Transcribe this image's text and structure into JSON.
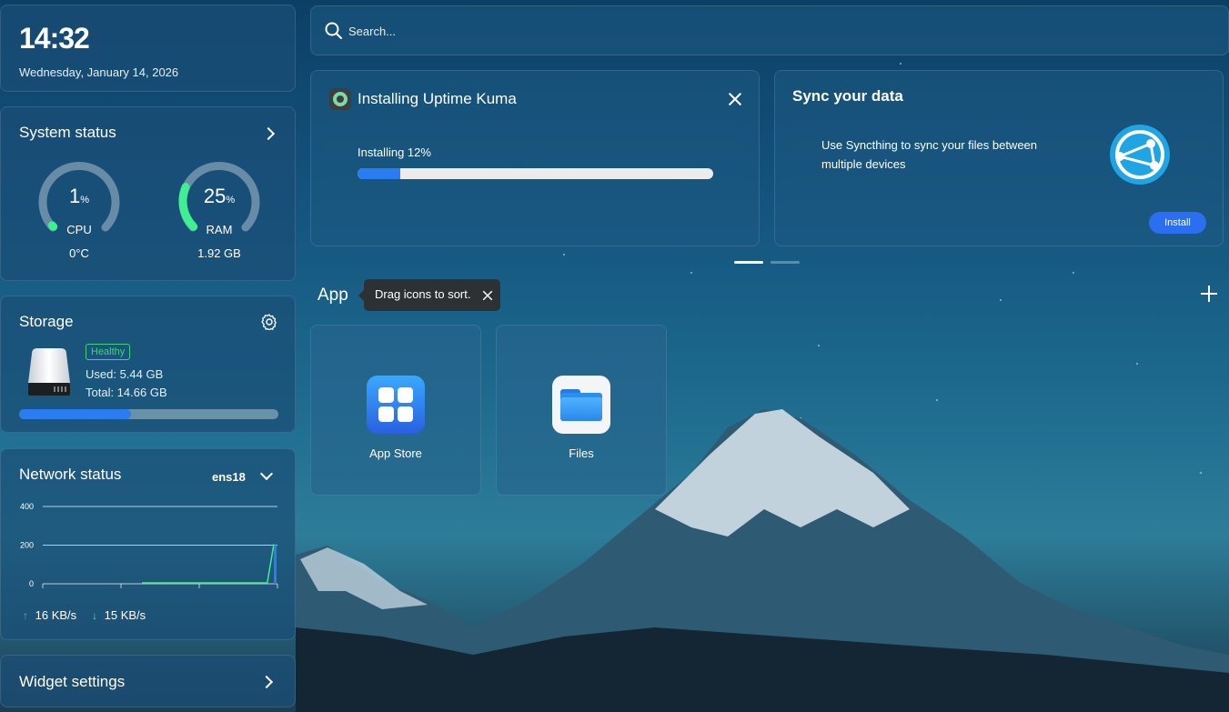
{
  "clock": {
    "time": "14:32",
    "date": "Wednesday, January 14, 2026"
  },
  "system_status": {
    "title": "System status",
    "cpu": {
      "value": "1",
      "unit": "%",
      "label": "CPU",
      "sub": "0°C",
      "percent": 1
    },
    "ram": {
      "value": "25",
      "unit": "%",
      "label": "RAM",
      "sub": "1.92 GB",
      "percent": 25
    }
  },
  "storage": {
    "title": "Storage",
    "badge": "Healthy",
    "used": "Used: 5.44 GB",
    "total": "Total: 14.66 GB",
    "fill_fraction": 0.43
  },
  "network": {
    "title": "Network status",
    "interface": "ens18",
    "upload": "16 KB/s",
    "download": "15 KB/s"
  },
  "widget_settings": {
    "label": "Widget settings"
  },
  "search": {
    "placeholder": "Search..."
  },
  "install_card": {
    "title": "Installing Uptime Kuma",
    "progress_label": "Installing 12%",
    "progress": 0.12
  },
  "sync_card": {
    "title": "Sync your data",
    "description": "Use Syncthing to sync your files between multiple devices",
    "button": "Install"
  },
  "apps_section": {
    "title": "App",
    "tooltip": "Drag icons to sort.",
    "apps": [
      {
        "label": "App Store",
        "icon": "app-store-icon"
      },
      {
        "label": "Files",
        "icon": "folder-icon"
      }
    ]
  },
  "chart_data": {
    "type": "line",
    "yticks": [
      "400",
      "200",
      "0"
    ],
    "ylim": [
      0,
      400
    ],
    "series": [
      {
        "values": [
          0,
          0,
          0,
          0,
          0,
          0,
          0,
          0,
          0,
          0,
          0,
          0,
          0,
          0,
          0,
          0,
          0,
          0,
          0,
          0,
          200
        ]
      }
    ]
  },
  "colors": {
    "accent": "#2b7cf0",
    "gauge": "#3ef08f",
    "healthy": "#3fd27f"
  }
}
